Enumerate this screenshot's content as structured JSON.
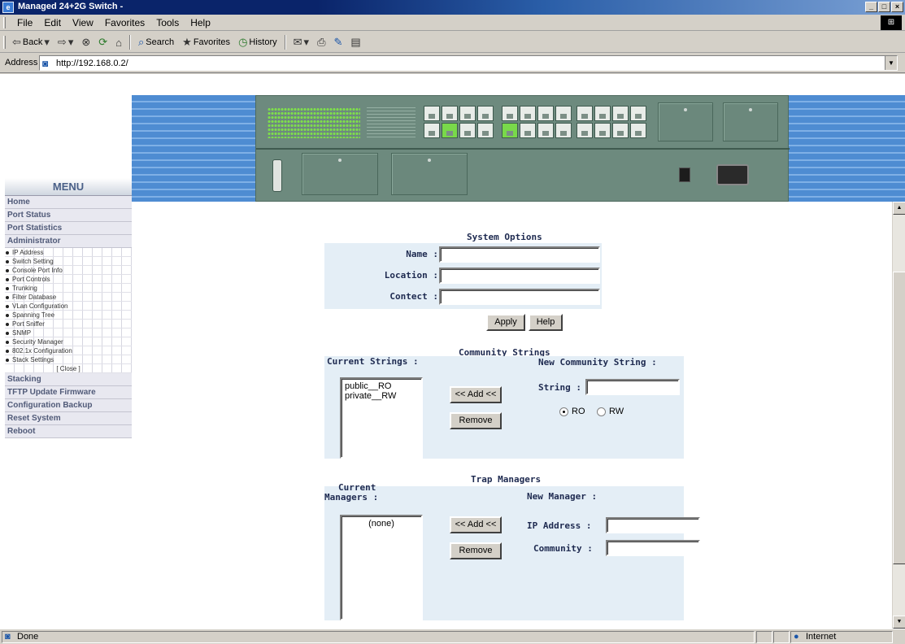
{
  "window": {
    "title": "Managed 24+2G Switch -",
    "min": "_",
    "max": "□",
    "close": "×"
  },
  "menubar": {
    "items": [
      "File",
      "Edit",
      "View",
      "Favorites",
      "Tools",
      "Help"
    ]
  },
  "toolbar": {
    "back": "Back",
    "search": "Search",
    "favorites": "Favorites",
    "history": "History"
  },
  "addressbar": {
    "label": "Address",
    "url": "http://192.168.0.2/"
  },
  "sidebar": {
    "menu_title": "MENU",
    "items": [
      "Home",
      "Port Status",
      "Port Statistics",
      "Administrator"
    ],
    "sub_items": [
      "IP Address",
      "Switch Setting",
      "Console Port Info",
      "Port Controls",
      "Trunking",
      "Filter Database",
      "VLan Configuration",
      "Spanning Tree",
      "Port Sniffer",
      "SNMP",
      "Security Manager",
      "802.1x Configuration",
      "Stack Settings"
    ],
    "close": "[ Close ]",
    "items_after": [
      "Stacking",
      "TFTP Update Firmware",
      "Configuration Backup",
      "Reset System",
      "Reboot"
    ]
  },
  "system_options": {
    "heading": "System Options",
    "name_label": "Name :",
    "location_label": "Location :",
    "contact_label": "Contect :",
    "name_value": "",
    "location_value": "",
    "contact_value": "",
    "apply": "Apply",
    "help": "Help"
  },
  "community": {
    "heading": "Community Strings",
    "current_label": "Current Strings :",
    "strings": [
      "public__RO",
      "private__RW"
    ],
    "add": "<< Add <<",
    "remove": "Remove",
    "new_label": "New Community String :",
    "string_label": "String :",
    "string_value": "",
    "ro": "RO",
    "rw": "RW",
    "selected": "RO"
  },
  "trap": {
    "heading": "Trap Managers",
    "current_label_1": "Current",
    "current_label_2": "Managers :",
    "managers": [
      "(none)"
    ],
    "add": "<< Add <<",
    "remove": "Remove",
    "new_label": "New Manager :",
    "ip_label": "IP Address :",
    "community_label": "Community :",
    "ip_value": "",
    "community_value": ""
  },
  "statusbar": {
    "status": "Done",
    "zone": "Internet"
  }
}
